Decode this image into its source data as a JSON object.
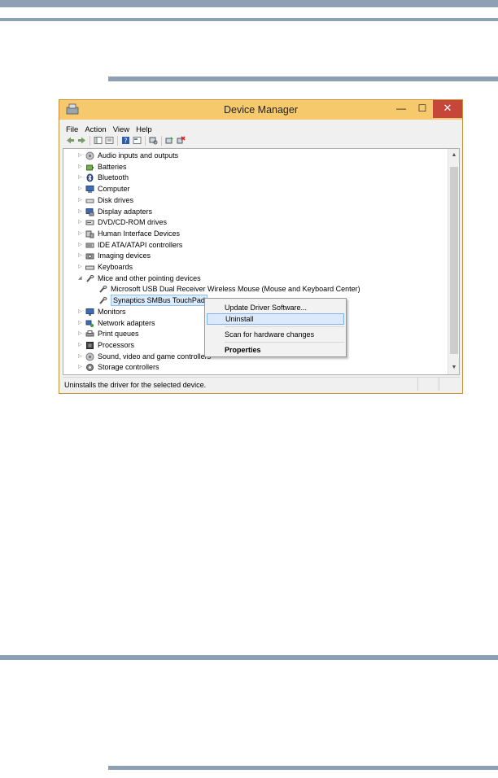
{
  "window": {
    "title": "Device Manager",
    "min_glyph": "—",
    "max_glyph": "☐",
    "close_glyph": "✕"
  },
  "menu": [
    "File",
    "Action",
    "View",
    "Help"
  ],
  "toolbar_icons": [
    "back-arrow-icon",
    "forward-arrow-icon",
    "show-hide-console-tree-icon",
    "properties-icon",
    "help-icon",
    "view-icon",
    "scan-hardware-icon",
    "update-driver-icon",
    "uninstall-icon"
  ],
  "tree": [
    {
      "label": "Audio inputs and outputs",
      "icon": "speaker-icon",
      "state": "collapsed",
      "indent": 0
    },
    {
      "label": "Batteries",
      "icon": "battery-icon",
      "state": "collapsed",
      "indent": 0
    },
    {
      "label": "Bluetooth",
      "icon": "bluetooth-icon",
      "state": "collapsed",
      "indent": 0
    },
    {
      "label": "Computer",
      "icon": "computer-icon",
      "state": "collapsed",
      "indent": 0
    },
    {
      "label": "Disk drives",
      "icon": "disk-drive-icon",
      "state": "collapsed",
      "indent": 0
    },
    {
      "label": "Display adapters",
      "icon": "display-adapter-icon",
      "state": "collapsed",
      "indent": 0
    },
    {
      "label": "DVD/CD-ROM drives",
      "icon": "dvd-drive-icon",
      "state": "collapsed",
      "indent": 0
    },
    {
      "label": "Human Interface Devices",
      "icon": "hid-icon",
      "state": "collapsed",
      "indent": 0
    },
    {
      "label": "IDE ATA/ATAPI controllers",
      "icon": "ide-controller-icon",
      "state": "collapsed",
      "indent": 0
    },
    {
      "label": "Imaging devices",
      "icon": "camera-icon",
      "state": "collapsed",
      "indent": 0
    },
    {
      "label": "Keyboards",
      "icon": "keyboard-icon",
      "state": "collapsed",
      "indent": 0
    },
    {
      "label": "Mice and other pointing devices",
      "icon": "mouse-icon",
      "state": "expanded",
      "indent": 0
    },
    {
      "label": "Microsoft USB Dual Receiver Wireless Mouse (Mouse and Keyboard Center)",
      "icon": "mouse-icon",
      "state": "leaf",
      "indent": 1
    },
    {
      "label": "Synaptics SMBus TouchPad",
      "icon": "mouse-icon",
      "state": "leaf",
      "indent": 1,
      "selected": true
    },
    {
      "label": "Monitors",
      "icon": "monitor-icon",
      "state": "collapsed",
      "indent": 0
    },
    {
      "label": "Network adapters",
      "icon": "network-icon",
      "state": "collapsed",
      "indent": 0
    },
    {
      "label": "Print queues",
      "icon": "printer-icon",
      "state": "collapsed",
      "indent": 0
    },
    {
      "label": "Processors",
      "icon": "processor-icon",
      "state": "collapsed",
      "indent": 0
    },
    {
      "label": "Sound, video and game controllers",
      "icon": "speaker-icon",
      "state": "collapsed",
      "indent": 0
    },
    {
      "label": "Storage controllers",
      "icon": "storage-controller-icon",
      "state": "collapsed",
      "indent": 0
    }
  ],
  "context_menu": {
    "items": [
      "Update Driver Software...",
      "Uninstall",
      "Scan for hardware changes",
      "Properties"
    ],
    "highlighted": "Uninstall"
  },
  "status": "Uninstalls the driver for the selected device.",
  "colors": {
    "titlebar": "#f5c96c",
    "close": "#c7463a",
    "rule": "#8ea0b4",
    "selection": "#dcebfc"
  }
}
